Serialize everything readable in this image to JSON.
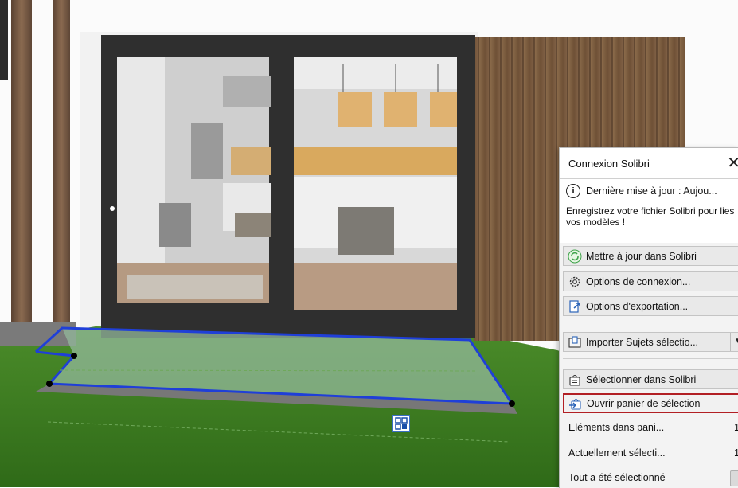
{
  "panel": {
    "title": "Connexion Solibri",
    "info_line": "Dernière mise à jour : Aujou...",
    "info_message": "Enregistrez votre fichier Solibri pour lies vos modèles !",
    "buttons": {
      "update": "Mettre à jour dans Solibri",
      "connection_options": "Options de connexion...",
      "export_options": "Options d'exportation...",
      "import_subjects": "Importer Sujets sélectio...",
      "select_in_solibri": "Sélectionner dans Solibri",
      "open_basket": "Ouvrir panier de sélection"
    },
    "stats": {
      "basket_label": "Eléments dans pani...",
      "basket_value": "1",
      "current_label": "Actuellement sélecti...",
      "current_value": "1",
      "all_selected_label": "Tout a été sélectionné"
    }
  },
  "colors": {
    "highlight_border": "#b21f24",
    "selection_outline": "#1f3fd8",
    "grass": "#3d7a22",
    "wood_panel": "#7a5a3e",
    "door_frame": "#2f2f2f"
  }
}
